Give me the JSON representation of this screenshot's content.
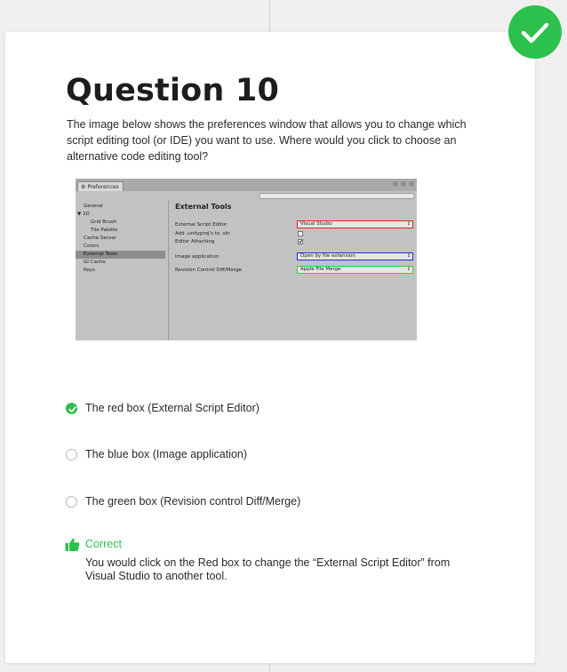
{
  "question": {
    "title": "Question 10",
    "text": " The image below shows the preferences window that allows you to change which script editing tool (or IDE) you want to use. Where would you click to choose an alternative code editing tool?"
  },
  "status": {
    "correct": true,
    "badge_icon": "checkmark-icon",
    "color": "#2bc14c"
  },
  "screenshot": {
    "window_tab": "Preferences",
    "sidebar_items": [
      {
        "label": "General",
        "indent": 0,
        "selected": false
      },
      {
        "label": "▼ 2D",
        "indent": 0,
        "selected": false
      },
      {
        "label": "Grid Brush",
        "indent": 1,
        "selected": false
      },
      {
        "label": "Tile Palette",
        "indent": 1,
        "selected": false
      },
      {
        "label": "Cache Server",
        "indent": 0,
        "selected": false
      },
      {
        "label": "Colors",
        "indent": 0,
        "selected": false
      },
      {
        "label": "External Tools",
        "indent": 0,
        "selected": true
      },
      {
        "label": "GI Cache",
        "indent": 0,
        "selected": false
      },
      {
        "label": "Keys",
        "indent": 0,
        "selected": false
      }
    ],
    "panel_title": "External Tools",
    "rows": {
      "external_script_editor": {
        "label": "External Script Editor",
        "value": "Visual Studio",
        "box_color": "#e0261f"
      },
      "add_unityproj": {
        "label": "Add .unityproj's to .sln",
        "checked": false
      },
      "editor_attaching": {
        "label": "Editor Attaching",
        "checked": true,
        "check_mark": "✔"
      },
      "image_application": {
        "label": "Image application",
        "value": "Open by file extension",
        "box_color": "#1d2fd6"
      },
      "revision_control": {
        "label": "Revision Control Diff/Merge",
        "value": "Apple File Merge",
        "box_color": "#2ad12a"
      }
    },
    "dropdown_arrow": "↕"
  },
  "options": [
    {
      "label": "The red box (External Script Editor)",
      "selected": true
    },
    {
      "label": "The blue box (Image application)",
      "selected": false
    },
    {
      "label": "The green box (Revision control Diff/Merge)",
      "selected": false
    }
  ],
  "feedback": {
    "title": "Correct",
    "icon": "thumbs-up-icon",
    "text": "You would click on the Red box to change the “External Script Editor” from Visual Studio to another tool."
  }
}
